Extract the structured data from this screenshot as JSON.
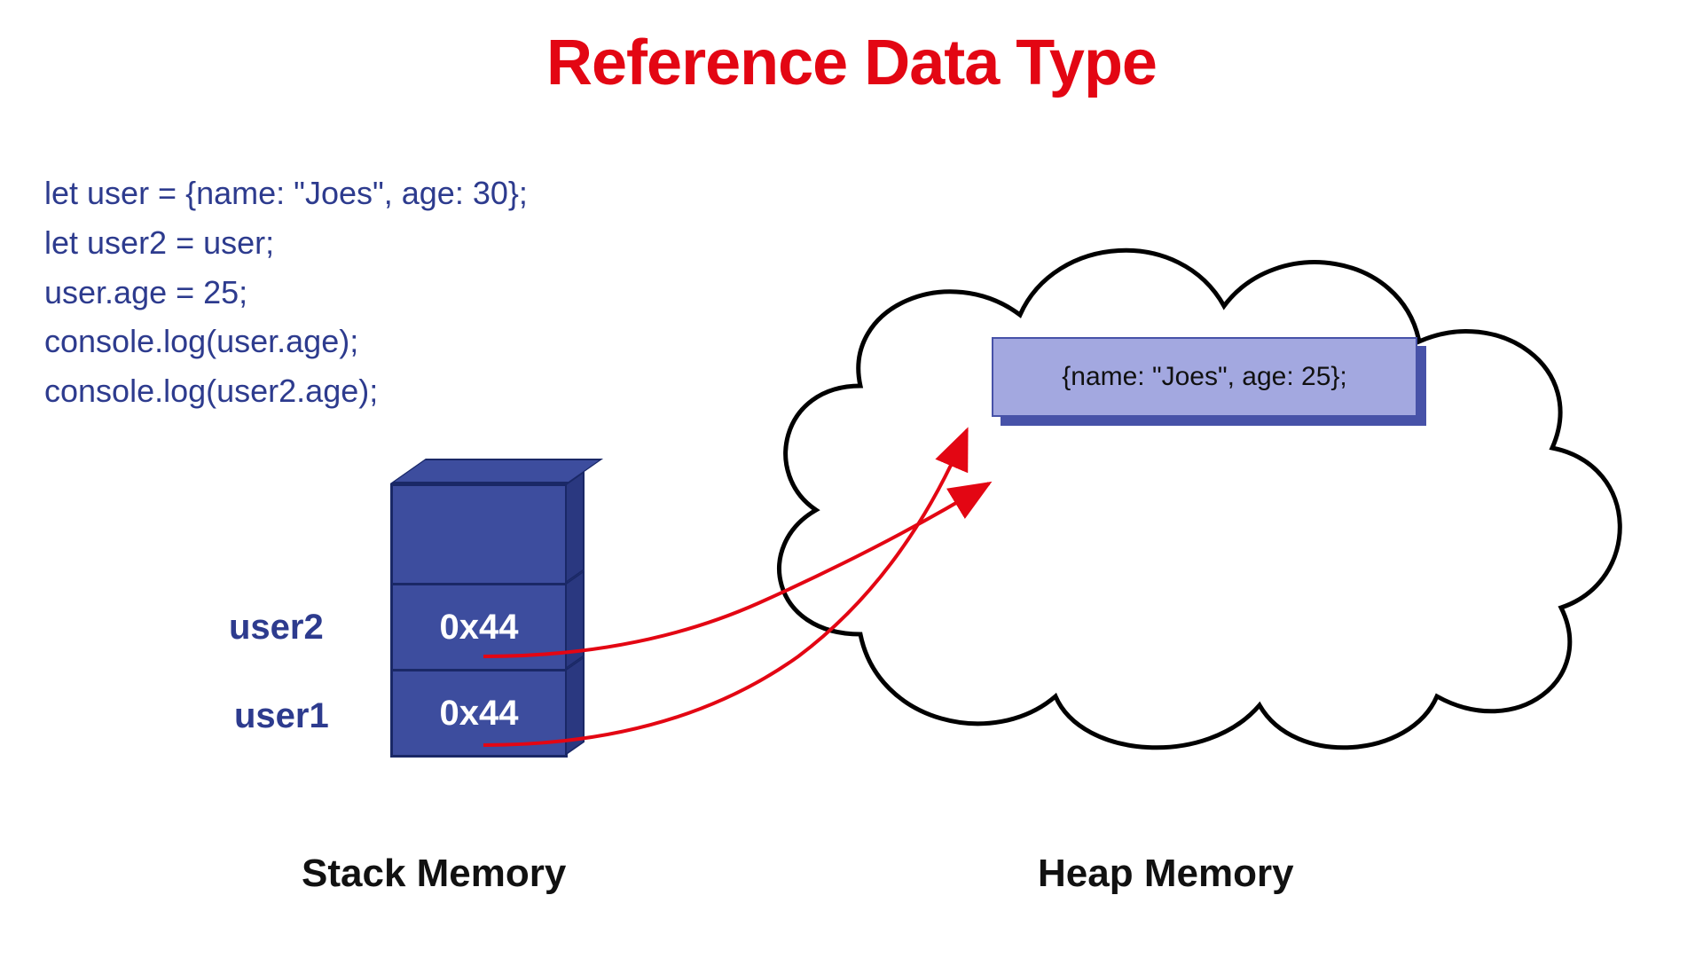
{
  "title": "Reference Data Type",
  "code": {
    "line1": "let user = {name: \"Joes\", age: 30};",
    "line2": "let user2 = user;",
    "line3": "user.age = 25;",
    "line4": "console.log(user.age);",
    "line5": "console.log(user2.age);"
  },
  "stack": {
    "user2_label": "user2",
    "user1_label": "user1",
    "user2_addr": "0x44",
    "user1_addr": "0x44",
    "title": "Stack Memory"
  },
  "heap": {
    "object_text": "{name: \"Joes\", age: 25};",
    "title": "Heap Memory"
  },
  "colors": {
    "title_red": "#e30613",
    "code_blue": "#2d3b8e",
    "cube_face": "#3d4d9e",
    "heap_box": "#a3a8e0",
    "arrow_red": "#e30613"
  }
}
